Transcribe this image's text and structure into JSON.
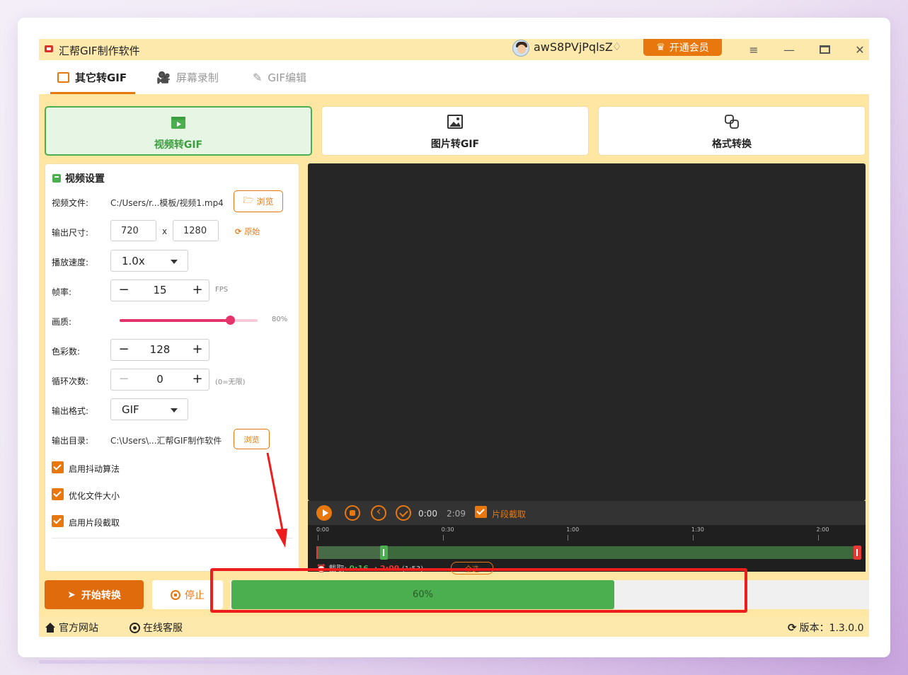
{
  "app": {
    "title": "汇帮GIF制作软件",
    "username": "awS8PVjPqlsZ",
    "vip_button": "开通会员",
    "version_label": "版本：1.3.0.0"
  },
  "top_tabs": [
    {
      "label": "其它转GIF",
      "active": true
    },
    {
      "label": "屏幕录制",
      "active": false
    },
    {
      "label": "GIF编辑",
      "active": false
    }
  ],
  "modes": [
    {
      "label": "视频转GIF",
      "active": true
    },
    {
      "label": "图片转GIF",
      "active": false
    },
    {
      "label": "格式转换",
      "active": false
    }
  ],
  "settings": {
    "title": "视频设置",
    "video_file_label": "视频文件:",
    "video_file_value": "C:/Users/r...模板/视频1.mp4",
    "browse": "浏览",
    "size_label": "输出尺寸:",
    "width": "720",
    "times": "x",
    "height": "1280",
    "original": "原始",
    "speed_label": "播放速度:",
    "speed_value": "1.0x",
    "fps_label": "帧率:",
    "fps_value": "15",
    "fps_unit": "FPS",
    "quality_label": "画质:",
    "quality_text": "80%",
    "quality_fraction": 0.8,
    "colors_label": "色彩数:",
    "colors_value": "128",
    "loop_label": "循环次数:",
    "loop_value": "0",
    "loop_hint": "(0=无限)",
    "format_label": "输出格式:",
    "format_value": "GIF",
    "outdir_label": "输出目录:",
    "outdir_value": "C:\\Users\\...汇帮GIF制作软件",
    "outdir_browse": "浏览",
    "checkboxes": [
      "启用抖动算法",
      "优化文件大小",
      "启用片段截取"
    ]
  },
  "player": {
    "current_time": "0:00",
    "total_time": "2:09",
    "clip_toggle": "片段截取",
    "ticks": [
      "0:00",
      "0:30",
      "1:00",
      "1:30",
      "2:00"
    ],
    "tick_seconds": [
      0,
      30,
      60,
      90,
      120
    ],
    "duration_seconds": 129,
    "clip_start_seconds": 16,
    "clip_end_seconds": 129,
    "clip_label": "截取:",
    "clip_start": "0:16",
    "clip_arrow": "→",
    "clip_end": "2:09",
    "clip_duration": "(1:53)",
    "select_all": "全选"
  },
  "actions": {
    "start": "开始转换",
    "stop": "停止",
    "progress_text": "60%",
    "progress_fraction": 0.6
  },
  "footer": {
    "website": "官方网站",
    "support": "在线客服"
  },
  "colors": {
    "accent_orange": "#e8780e",
    "success_green": "#4bae4f",
    "annotation_red": "#ee1d1d",
    "app_background": "#ffe7a3"
  }
}
